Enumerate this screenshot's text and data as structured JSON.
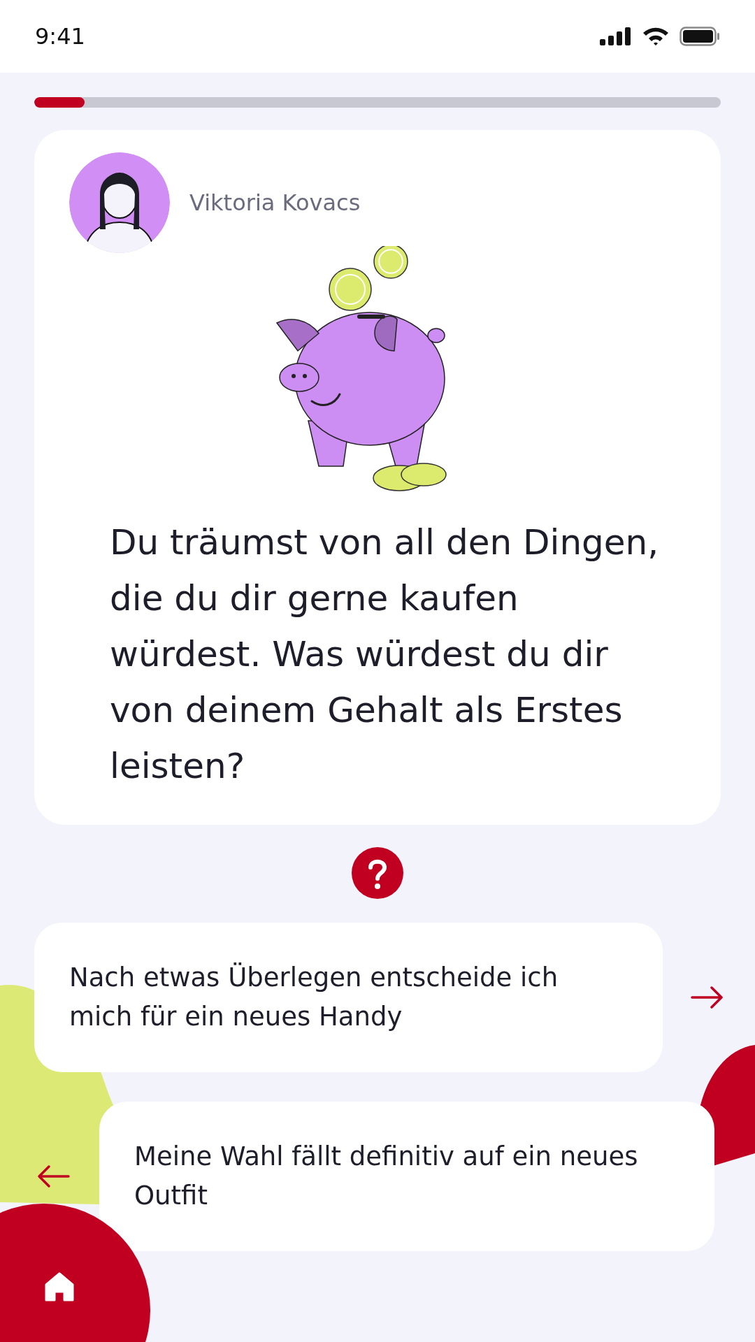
{
  "status_bar": {
    "time": "9:41"
  },
  "progress": {
    "level": 0.073
  },
  "card": {
    "author": "Viktoria Kovacs",
    "question": "Du träumst von all den Dingen, die du dir gerne kaufen würdest. Was würdest du dir von deinem Gehalt als Erstes leisten?"
  },
  "answers": [
    {
      "kind": "right",
      "text": "Nach etwas Überlegen entscheide ich mich für ein neues Handy"
    },
    {
      "kind": "left",
      "text": "Meine Wahl fällt definitiv auf ein neues Outfit"
    }
  ]
}
